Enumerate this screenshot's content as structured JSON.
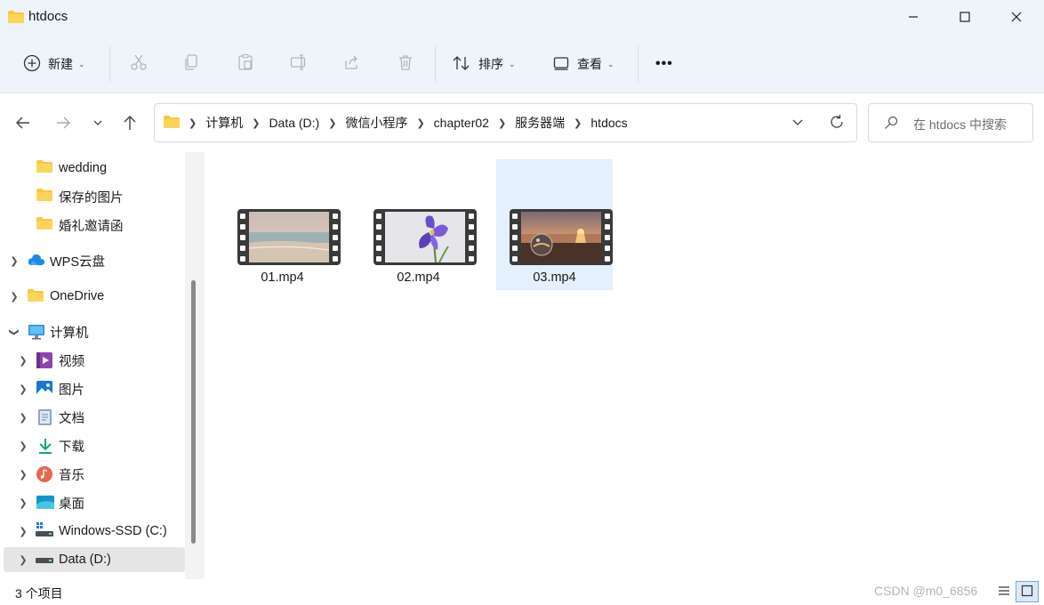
{
  "window": {
    "title": "htdocs",
    "minimize_icon": "minimize-icon",
    "maximize_icon": "maximize-icon",
    "close_icon": "close-icon"
  },
  "toolbar": {
    "new_label": "新建",
    "sort_label": "排序",
    "view_label": "查看",
    "more_label": "•••",
    "icons": [
      "cut-icon",
      "copy-icon",
      "paste-icon",
      "rename-icon",
      "share-icon",
      "delete-icon"
    ]
  },
  "navigation": {
    "breadcrumb": [
      "计算机",
      "Data (D:)",
      "微信小程序",
      "chapter02",
      "服务器端",
      "htdocs"
    ],
    "search_placeholder": "在 htdocs 中搜索"
  },
  "sidebar": {
    "items": [
      {
        "label": "wedding",
        "icon": "folder-icon"
      },
      {
        "label": "保存的图片",
        "icon": "folder-icon"
      },
      {
        "label": "婚礼邀请函",
        "icon": "folder-icon"
      },
      {
        "label": "WPS云盘",
        "icon": "cloud-icon"
      },
      {
        "label": "OneDrive",
        "icon": "folder-icon"
      },
      {
        "label": "计算机",
        "icon": "computer-icon"
      },
      {
        "label": "视频",
        "icon": "video-icon"
      },
      {
        "label": "图片",
        "icon": "pictures-icon"
      },
      {
        "label": "文档",
        "icon": "document-icon"
      },
      {
        "label": "下载",
        "icon": "download-icon"
      },
      {
        "label": "音乐",
        "icon": "music-icon"
      },
      {
        "label": "桌面",
        "icon": "desktop-icon"
      },
      {
        "label": "Windows-SSD (C:)",
        "icon": "drive-icon"
      },
      {
        "label": "Data (D:)",
        "icon": "drive-icon"
      }
    ],
    "selected": "Data (D:)"
  },
  "files": [
    {
      "name": "01.mp4",
      "thumbnail": "beach-at-dusk"
    },
    {
      "name": "02.mp4",
      "thumbnail": "purple-iris-flower"
    },
    {
      "name": "03.mp4",
      "thumbnail": "crystal-ball-sunset"
    }
  ],
  "selected_file": "03.mp4",
  "status": {
    "item_count": "3 个项目",
    "watermark": "CSDN @m0_6856"
  },
  "colors": {
    "accent": "#0067c0",
    "folder": "#f8c73b",
    "selection": "#e4f0fb"
  }
}
